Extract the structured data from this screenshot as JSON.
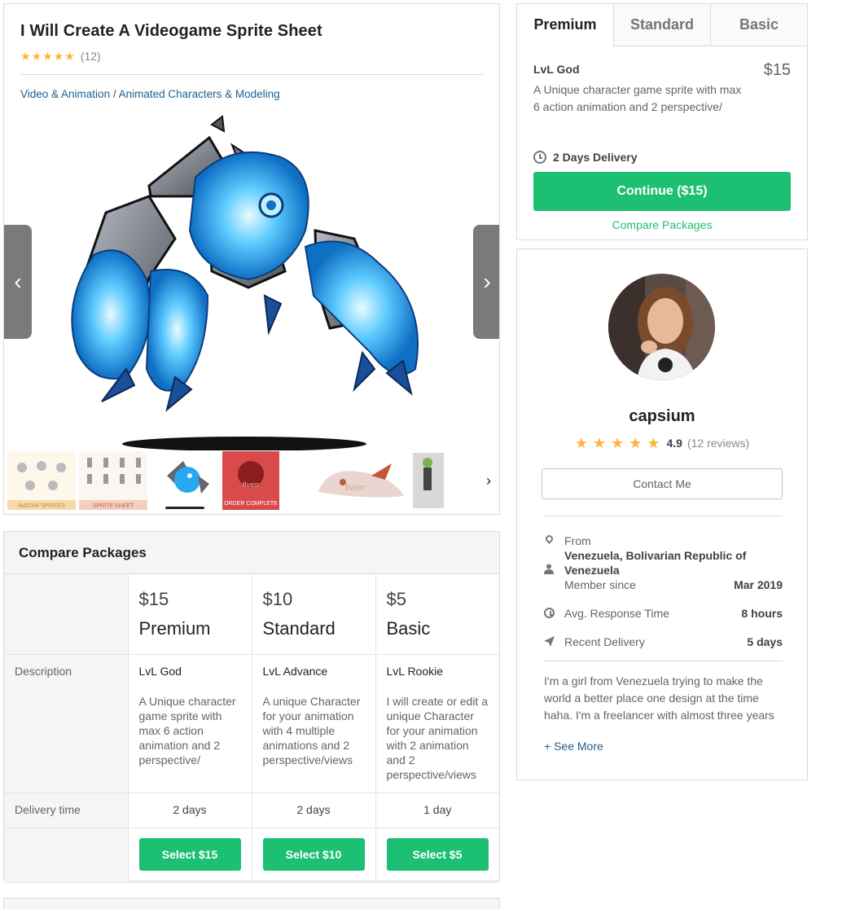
{
  "gig": {
    "title": "I Will Create A Videogame Sprite Sheet",
    "rating_stars": 5,
    "rating_count": "(12)",
    "breadcrumb": [
      "Video & Animation",
      "Animated Characters & Modeling"
    ],
    "breadcrumb_sep": " / ",
    "thumbnails": [
      "avatar-sprites-thumb",
      "sprite-sheet-thumb",
      "blue-monster-thumb",
      "order-complete-thumb",
      "dragon-skull-thumb",
      "green-character-thumb"
    ],
    "thumb_texts": {
      "t1": "AVATAR SPRITES",
      "t2": "SPRITE SHEET",
      "t4": "ORDER COMPLETE",
      "t4b": "fiverr",
      "t5": "fiverr"
    }
  },
  "compare": {
    "heading": "Compare Packages",
    "row_labels": {
      "description": "Description",
      "delivery": "Delivery time"
    },
    "packages": [
      {
        "price": "$15",
        "name": "Premium",
        "title": "LvL God",
        "desc": "A Unique character game sprite with max 6 action animation and 2 perspective/",
        "delivery": "2 days",
        "button": "Select $15"
      },
      {
        "price": "$10",
        "name": "Standard",
        "title": "LvL Advance",
        "desc": "A unique Character for your animation with 4 multiple animations and 2 perspective/views",
        "delivery": "2 days",
        "button": "Select $10"
      },
      {
        "price": "$5",
        "name": "Basic",
        "title": "LvL Rookie",
        "desc": "I will create or edit a unique Character for your animation with 2 animation and 2 perspective/views",
        "delivery": "1 day",
        "button": "Select $5"
      }
    ]
  },
  "package_card": {
    "tabs": [
      "Premium",
      "Standard",
      "Basic"
    ],
    "active_tab": "Premium",
    "title": "LvL God",
    "price": "$15",
    "description": "A Unique character game sprite with max 6 action animation and 2 perspective/",
    "delivery": "2 Days Delivery",
    "continue_label": "Continue ($15)",
    "compare_link": "Compare Packages"
  },
  "seller": {
    "name": "capsium",
    "rating_stars": 5,
    "score": "4.9",
    "reviews": "(12 reviews)",
    "contact_label": "Contact Me",
    "from_label": "From",
    "from_value": "Venezuela, Bolivarian Republic of Venezuela",
    "member_label": "Member since",
    "member_value": "Mar 2019",
    "response_label": "Avg. Response Time",
    "response_value": "8 hours",
    "delivery_label": "Recent Delivery",
    "delivery_value": "5 days",
    "bio": "I'm a girl from Venezuela trying to make the world a better place one design at the time haha. I'm a freelancer with almost three years",
    "see_more": "+ See More"
  },
  "colors": {
    "accent": "#1dbf73",
    "star": "#ffb33e",
    "link": "#1e5f8c",
    "monster_blue": "#29a8f0"
  }
}
